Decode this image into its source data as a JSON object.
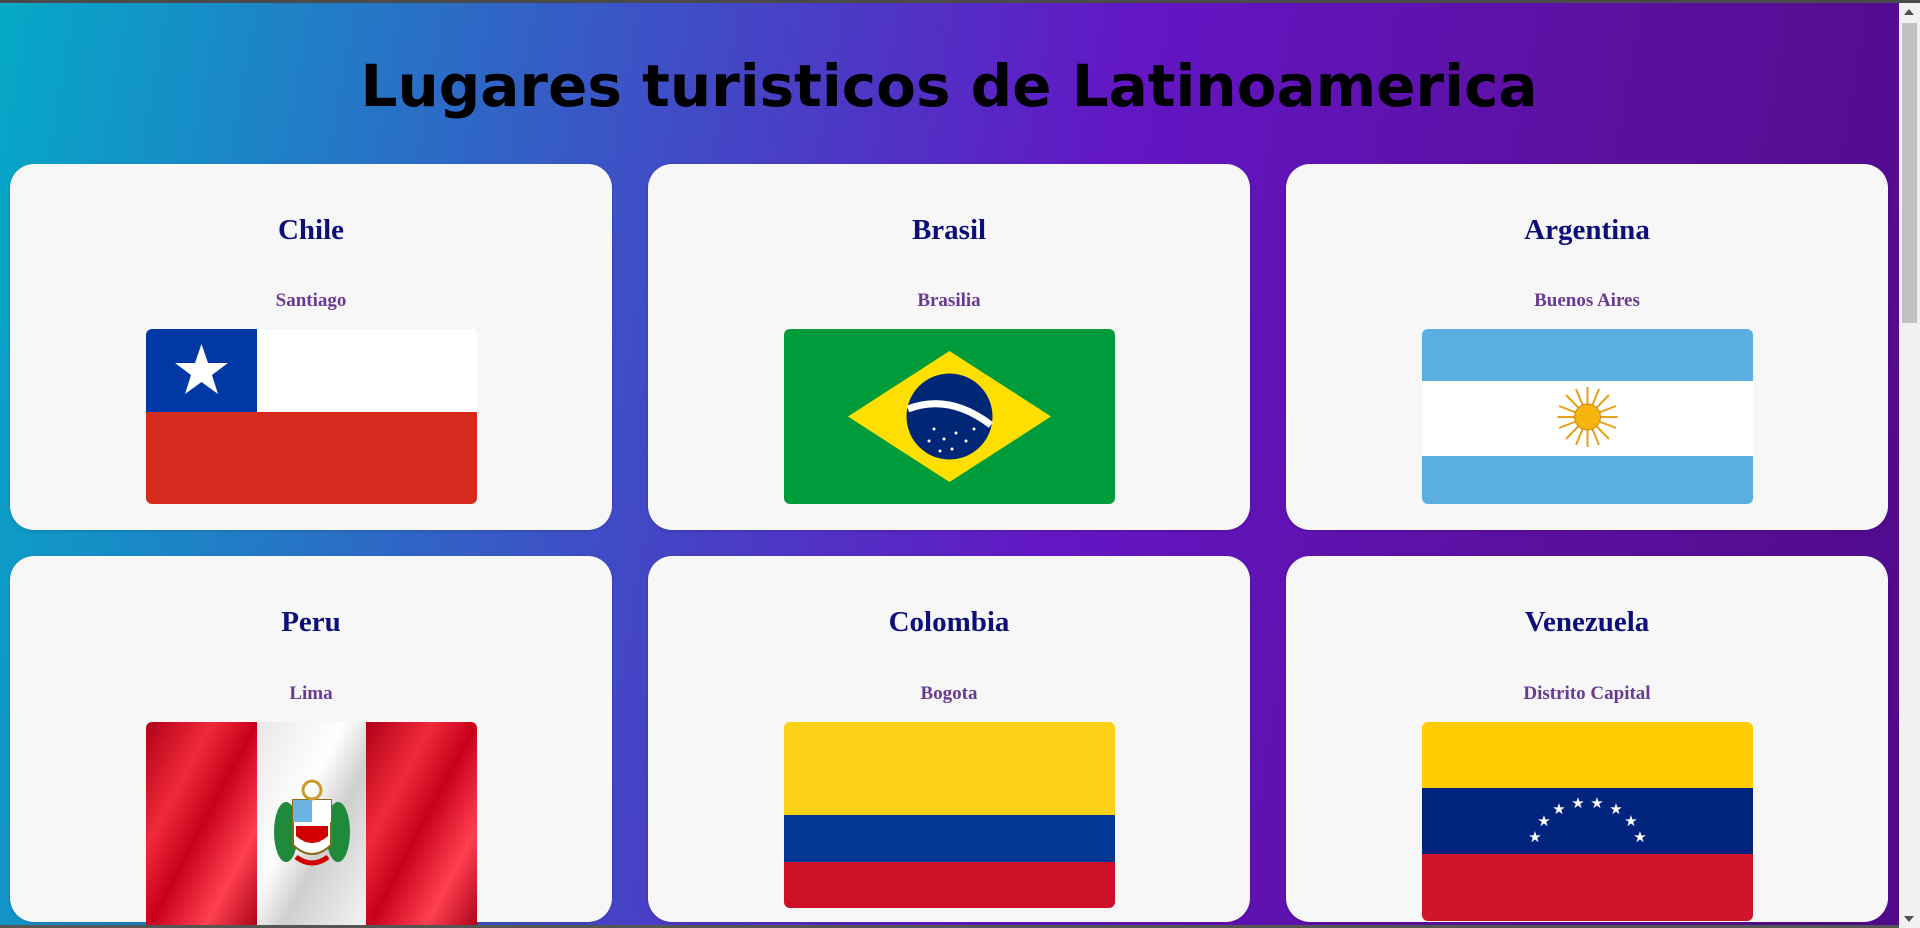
{
  "page": {
    "title": "Lugares turisticos de Latinoamerica"
  },
  "cards": [
    {
      "country": "Chile",
      "capital": "Santiago",
      "flag_icon": "chile-flag"
    },
    {
      "country": "Brasil",
      "capital": "Brasilia",
      "flag_icon": "brazil-flag"
    },
    {
      "country": "Argentina",
      "capital": "Buenos Aires",
      "flag_icon": "argentina-flag"
    },
    {
      "country": "Peru",
      "capital": "Lima",
      "flag_icon": "peru-flag"
    },
    {
      "country": "Colombia",
      "capital": "Bogota",
      "flag_icon": "colombia-flag"
    },
    {
      "country": "Venezuela",
      "capital": "Distrito Capital",
      "flag_icon": "venezuela-flag"
    }
  ],
  "colors": {
    "country_text": "#0c0f7a",
    "capital_text": "#6a3a93",
    "card_background": "#f7f7f7"
  }
}
